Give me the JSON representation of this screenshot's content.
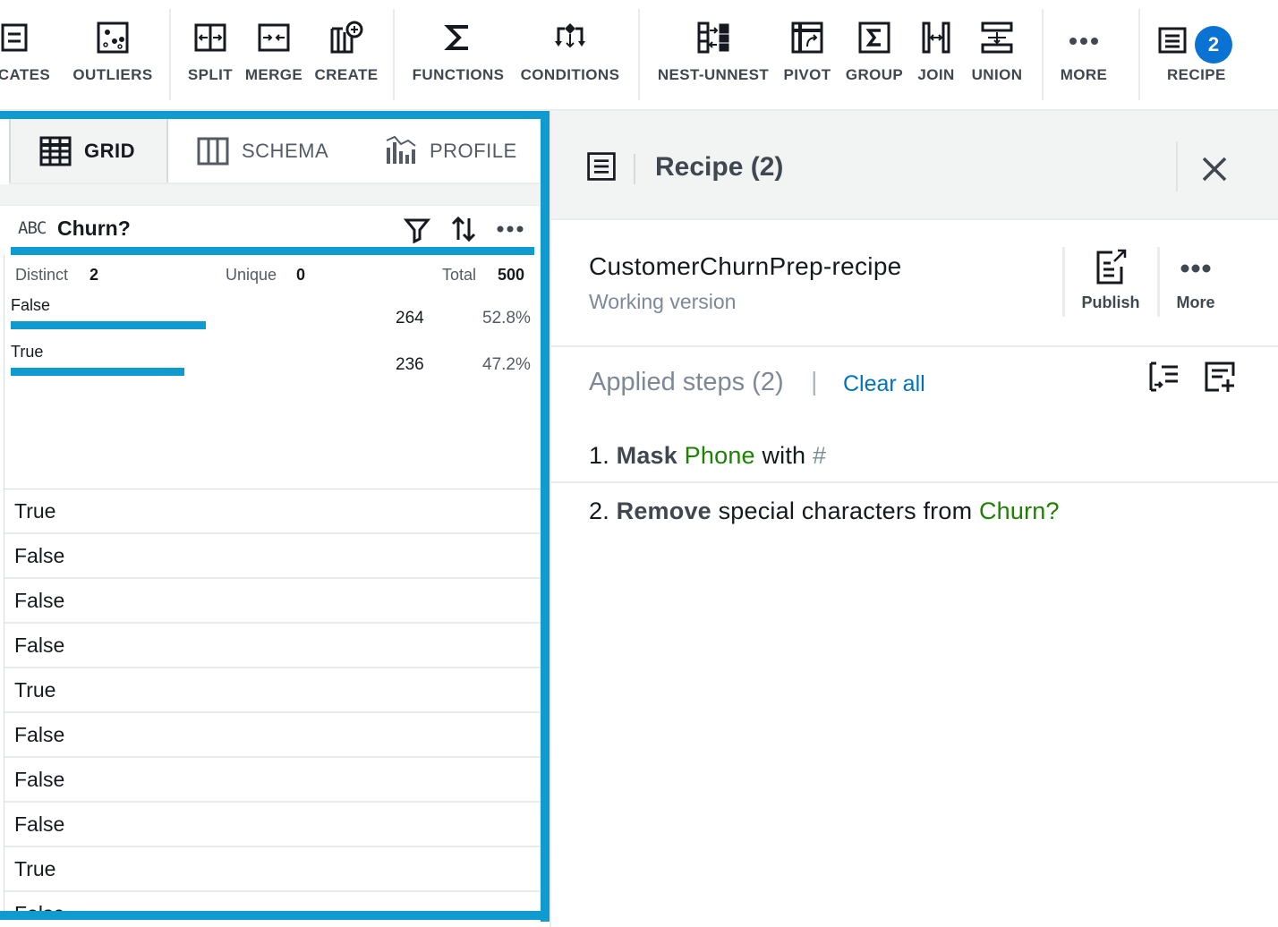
{
  "toolbar": {
    "buttons": [
      {
        "label": "LICATES",
        "icon": "duplicates-icon"
      },
      {
        "label": "OUTLIERS",
        "icon": "outliers-icon"
      },
      {
        "label": "SPLIT",
        "icon": "split-icon"
      },
      {
        "label": "MERGE",
        "icon": "merge-icon"
      },
      {
        "label": "CREATE",
        "icon": "create-column-icon"
      },
      {
        "label": "FUNCTIONS",
        "icon": "sigma-icon"
      },
      {
        "label": "CONDITIONS",
        "icon": "conditions-icon"
      },
      {
        "label": "NEST-UNNEST",
        "icon": "nest-unnest-icon"
      },
      {
        "label": "PIVOT",
        "icon": "pivot-icon"
      },
      {
        "label": "GROUP",
        "icon": "group-icon"
      },
      {
        "label": "JOIN",
        "icon": "join-icon"
      },
      {
        "label": "UNION",
        "icon": "union-icon"
      },
      {
        "label": "MORE",
        "icon": "more-icon"
      },
      {
        "label": "RECIPE",
        "icon": "recipe-icon",
        "badge": "2"
      }
    ]
  },
  "grid": {
    "tabs": [
      {
        "label": "GRID",
        "icon": "grid-icon",
        "active": true
      },
      {
        "label": "SCHEMA",
        "icon": "schema-icon",
        "active": false
      },
      {
        "label": "PROFILE",
        "icon": "profile-icon",
        "active": false
      }
    ],
    "column": {
      "type": "ABC",
      "name": "Churn?",
      "stats": {
        "distinct_label": "Distinct",
        "distinct": "2",
        "unique_label": "Unique",
        "unique": "0",
        "total_label": "Total",
        "total": "500"
      },
      "distribution": [
        {
          "value": "False",
          "count": "264",
          "percent": "52.8%",
          "fraction": 0.528
        },
        {
          "value": "True",
          "count": "236",
          "percent": "47.2%",
          "fraction": 0.472
        }
      ]
    },
    "rows": [
      "True",
      "False",
      "False",
      "False",
      "True",
      "False",
      "False",
      "False",
      "True",
      "False"
    ]
  },
  "recipe": {
    "title": "Recipe (2)",
    "name": "CustomerChurnPrep-recipe",
    "version": "Working version",
    "publish_label": "Publish",
    "more_label": "More",
    "steps_title": "Applied steps (2)",
    "steps_pipe": "|",
    "clear_all": "Clear all",
    "steps": [
      {
        "num": "1.",
        "action": "Mask",
        "column": "Phone",
        "middle": "with",
        "symbol": "#"
      },
      {
        "num": "2.",
        "action": "Remove",
        "middle": "special characters from",
        "column": "Churn?"
      }
    ]
  },
  "colors": {
    "accent": "#0f9bce",
    "link": "#0073bb",
    "badge": "#0972d3",
    "column_name": "#1d8102"
  }
}
